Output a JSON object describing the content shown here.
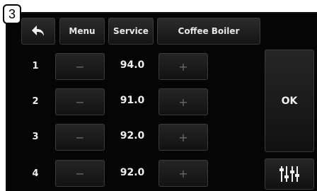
{
  "figure_label": "3",
  "header": {
    "back_icon": "back-arrow-icon",
    "menu_label": "Menu",
    "service_label": "Service",
    "section_label": "Coffee Boiler"
  },
  "rows": [
    {
      "index": "1",
      "minus": "−",
      "value": "94.0",
      "plus": "+"
    },
    {
      "index": "2",
      "minus": "−",
      "value": "91.0",
      "plus": "+"
    },
    {
      "index": "3",
      "minus": "−",
      "value": "92.0",
      "plus": "+"
    },
    {
      "index": "4",
      "minus": "−",
      "value": "92.0",
      "plus": "+"
    }
  ],
  "side": {
    "ok_label": "OK",
    "settings_icon": "equalizer-sliders-icon"
  }
}
